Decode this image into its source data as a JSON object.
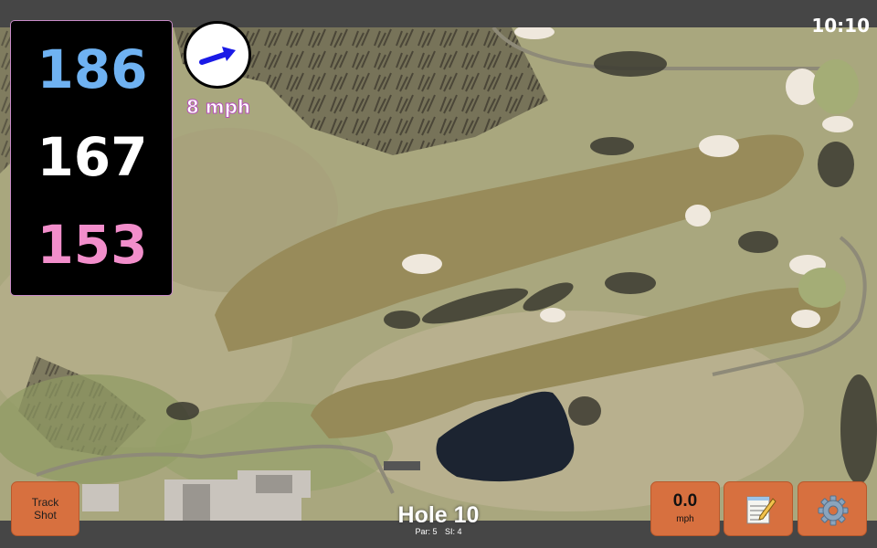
{
  "clock": "10:10",
  "distances": {
    "back": "186",
    "middle": "167",
    "front": "153"
  },
  "colors": {
    "back": "#6fb2f2",
    "middle": "#ffffff",
    "front": "#f28ecb",
    "button": "#d7703f",
    "wind_arrow": "#1a1ae6"
  },
  "wind": {
    "speed": "8 mph",
    "arrow_icon": "wind-direction-arrow"
  },
  "buttons": {
    "track_shot_line1": "Track",
    "track_shot_line2": "Shot",
    "speed_value": "0.0",
    "speed_unit": "mph",
    "notes_icon": "notepad-icon",
    "settings_icon": "gear-icon"
  },
  "hole": {
    "title": "Hole 10",
    "par": "Par: 5",
    "si": "SI: 4"
  }
}
